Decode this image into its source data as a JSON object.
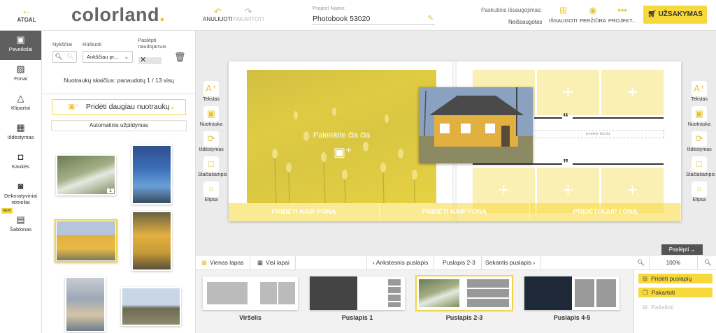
{
  "header": {
    "back_label": "ATGAL",
    "logo_text": "colorland",
    "logo_dot": ".",
    "undo_label": "ANULIUOTI",
    "redo_label": "PAKARTOTI",
    "project_label": "Project Name:",
    "project_name": "Photobook 53020",
    "last_saved_label": "Paskutinis išsaugojimas:",
    "last_saved_value": "Neišsaugotas",
    "save_label": "IŠSAUGOTI",
    "preview_label": "PERŽIŪRA",
    "project_menu_label": "PROJEKT...",
    "order_label": "UŽSAKYMAS"
  },
  "nav": {
    "items": [
      {
        "label": "Paveikslai",
        "icon": "image-icon"
      },
      {
        "label": "Fonai",
        "icon": "pattern-icon"
      },
      {
        "label": "Klipartai",
        "icon": "shapes-icon"
      },
      {
        "label": "Išdėstymas",
        "icon": "layout-icon"
      },
      {
        "label": "Kaukės",
        "icon": "mask-icon"
      },
      {
        "label": "Dekoratyviniai rėmeliai",
        "icon": "frame-icon"
      },
      {
        "label": "Šablonas",
        "icon": "template-icon"
      }
    ],
    "new_badge": "NEW"
  },
  "panel": {
    "thumbs_label": "Nykščiai",
    "sort_label": "Rūšiuoti",
    "sort_value": "Ankščiau pr...",
    "hide_used_label": "Paslėpti naudojamus",
    "count_text": "Nuotraukų skaičius: panaudotų 1 / 13 visų",
    "add_photos_label": "Pridėti daugiau nuotraukų",
    "autofill_label": "Automatinis užpildymas",
    "photo_badge": "1"
  },
  "tools": {
    "left": [
      "Tekstas",
      "Nuotrauka",
      "Išdėstymas",
      "Stačiakampis",
      "Elipsa"
    ],
    "right": [
      "Tekstas",
      "Nuotrauka",
      "Išdėstymas",
      "Stačiakampis",
      "Elipsa"
    ]
  },
  "spread": {
    "drop_text": "Paleiskite čia čia",
    "text_placeholder": "įveskite tekstą",
    "add_bg_labels": [
      "PRIDĖTI KAIP FONĄ",
      "PRIDĖTI KAIP FONĄ",
      "PRIDĖTI KAIP FONĄ"
    ],
    "hide_label": "Paslėpti"
  },
  "pagebar": {
    "single_page": "Vienas lapas",
    "all_pages": "Visi lapai",
    "prev": "Ankstesnis puslapis",
    "current": "Puslapis 2-3",
    "next": "Sekantis puslapis",
    "zoom": "100%"
  },
  "thumbnails": [
    "Viršelis",
    "Puslapis 1",
    "Puslapis 2-3",
    "Puslapis 4-5"
  ],
  "page_actions": {
    "add_page": "Pridėti puslapių",
    "repeat": "Pakartoti",
    "delete": "Pašalinti"
  },
  "colors": {
    "accent": "#f7d93c",
    "nav_active": "#5f5f5f"
  }
}
